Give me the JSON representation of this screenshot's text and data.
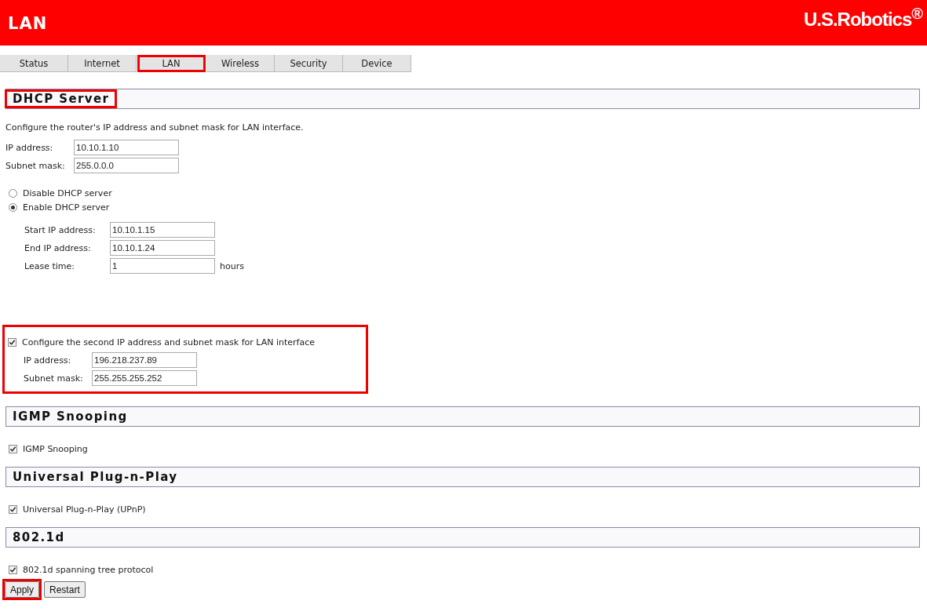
{
  "header": {
    "title": "LAN",
    "logo": "U.S.Robotics$^{®}$"
  },
  "tabs": [
    {
      "label": "Status",
      "highlighted": false
    },
    {
      "label": "Internet",
      "highlighted": false
    },
    {
      "label": "LAN",
      "highlighted": true
    },
    {
      "label": "Wireless",
      "highlighted": false
    },
    {
      "label": "Security",
      "highlighted": false
    },
    {
      "label": "Device",
      "highlighted": false
    }
  ],
  "dhcp": {
    "title": "DHCP Server",
    "highlighted": true,
    "description": "Configure the router's IP address and subnet mask for LAN interface.",
    "fields": [
      {
        "label": "IP address:",
        "value": "10.10.1.10"
      },
      {
        "label": "Subnet mask:",
        "value": "255.0.0.0"
      }
    ],
    "radios": [
      {
        "label": "Disable DHCP server",
        "selected": false
      },
      {
        "label": "Enable DHCP server",
        "selected": true
      }
    ],
    "range_fields": [
      {
        "label": "Start IP address:",
        "value": "10.10.1.15"
      },
      {
        "label": "End IP address:",
        "value": "10.10.1.24"
      },
      {
        "label": "Lease time:",
        "value": "1",
        "unit": "hours"
      }
    ],
    "second_ip": {
      "highlighted": true,
      "checked": true,
      "label": "Configure the second IP address and subnet mask for LAN interface",
      "fields": [
        {
          "label": "IP address:",
          "value": "196.218.237.89"
        },
        {
          "label": "Subnet mask:",
          "value": "255.255.255.252"
        }
      ]
    }
  },
  "sections": [
    {
      "title": "IGMP Snooping",
      "highlighted": false,
      "option": {
        "label": "IGMP Snooping",
        "checked": true
      }
    },
    {
      "title": "Universal Plug-n-Play",
      "highlighted": false,
      "option": {
        "label": "Universal Plug-n-Play (UPnP)",
        "checked": true
      }
    },
    {
      "title": "802.1d",
      "highlighted": false,
      "option": {
        "label": "802.1d spanning tree protocol",
        "checked": true
      }
    }
  ],
  "buttons": [
    {
      "label": "Apply",
      "highlighted": true
    },
    {
      "label": "Restart",
      "highlighted": false
    }
  ]
}
